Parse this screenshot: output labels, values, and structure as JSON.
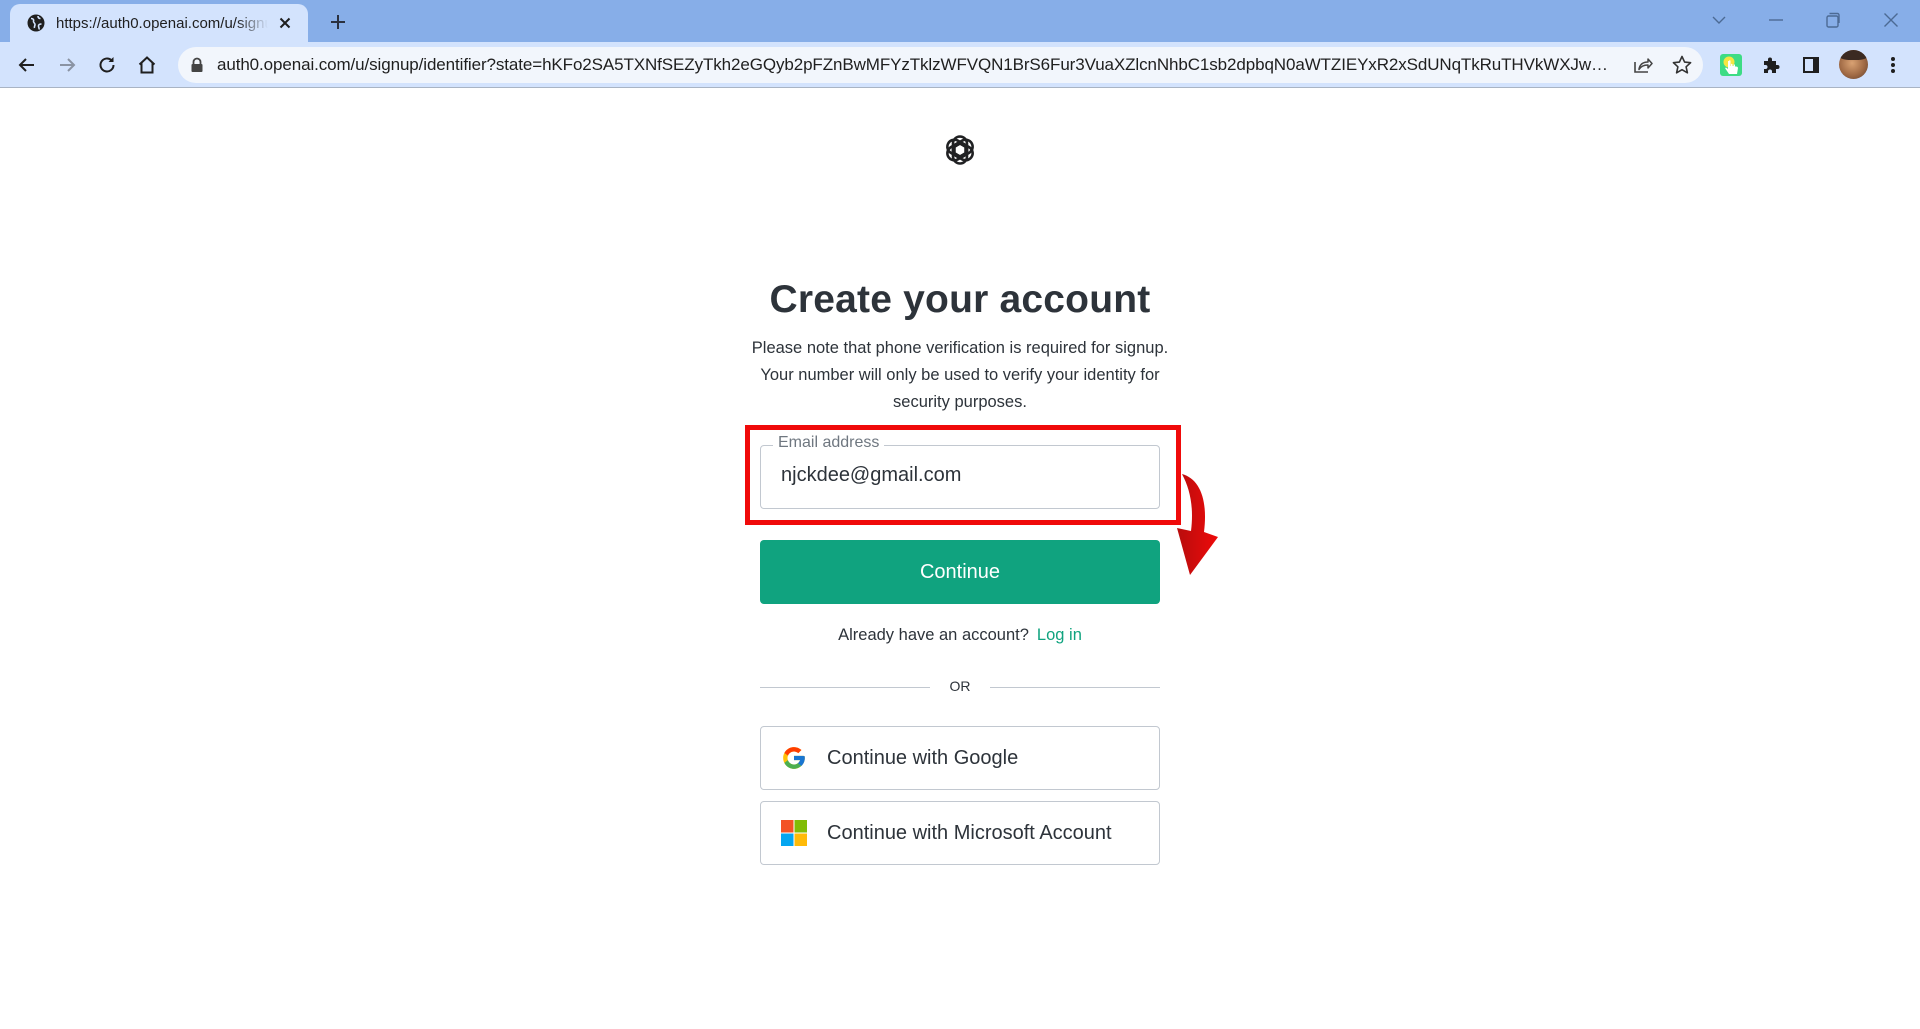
{
  "browser": {
    "tab": {
      "title": "https://auth0.openai.com/u/signup/identifier",
      "icon": "globe-icon",
      "close_icon": "close-icon"
    },
    "new_tab_icon": "plus-icon",
    "window_controls": [
      "chevron-down-icon",
      "minimize-icon",
      "restore-icon",
      "close-icon"
    ],
    "nav": [
      "back-arrow-icon",
      "forward-arrow-icon",
      "reload-icon",
      "home-icon"
    ],
    "address_bar": {
      "url": "auth0.openai.com/u/signup/identifier?state=hKFo2SA5TXNfSEZyTkh2eGQyb2pFZnBwMFYzTklzWFVQN1BrS6Fur3VuaXZlcnNhbC1sb2dpbqN0aWTZIEYxR2xSdUNqTkRuTHVkWXJwT...",
      "lock_icon": "lock-icon",
      "actions": [
        "share-icon",
        "star-icon"
      ]
    },
    "toolbar_icons": [
      "extension-touch-icon",
      "puzzle-icon",
      "sidebar-icon",
      "avatar",
      "kebab-menu-icon"
    ]
  },
  "page": {
    "logo": "openai-logo-icon",
    "title": "Create your account",
    "subtitle": "Please note that phone verification is required for signup. Your number will only be used to verify your identity for security purposes.",
    "email_field": {
      "label": "Email address",
      "value": "njckdee@gmail.com"
    },
    "continue_label": "Continue",
    "login_prompt": "Already have an account?",
    "login_link": "Log in",
    "divider_text": "OR",
    "social_buttons": [
      {
        "label": "Continue with Google",
        "icon": "google-icon"
      },
      {
        "label": "Continue with Microsoft Account",
        "icon": "microsoft-icon"
      }
    ],
    "colors": {
      "accent": "#10a37f",
      "text": "#2d333a",
      "annotation": "#f00a0a"
    }
  }
}
